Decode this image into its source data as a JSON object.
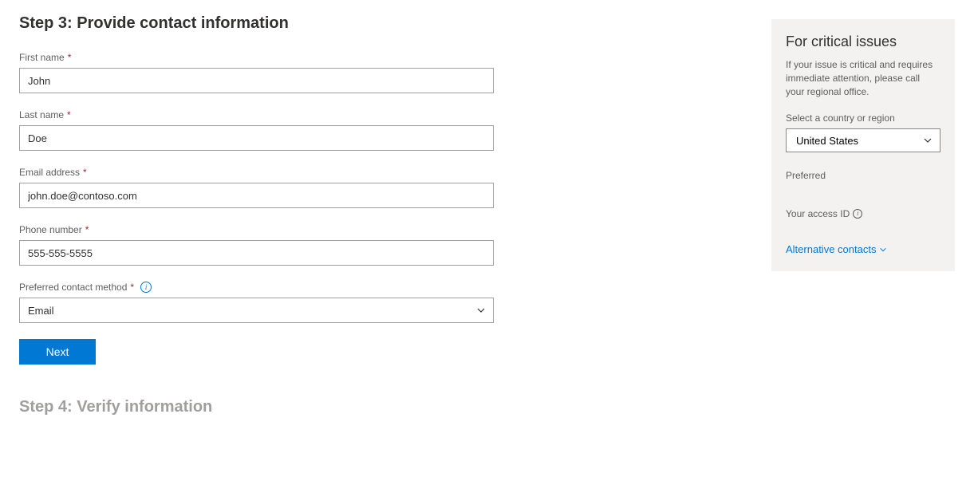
{
  "step3": {
    "title": "Step 3: Provide contact information",
    "firstNameLabel": "First name",
    "firstNameValue": "John",
    "lastNameLabel": "Last name",
    "lastNameValue": "Doe",
    "emailLabel": "Email address",
    "emailValue": "john.doe@contoso.com",
    "phoneLabel": "Phone number",
    "phoneValue": "555-555-5555",
    "contactMethodLabel": "Preferred contact method",
    "contactMethodValue": "Email",
    "nextButton": "Next"
  },
  "step4": {
    "title": "Step 4: Verify information"
  },
  "sidebar": {
    "title": "For critical issues",
    "description": "If your issue is critical and requires immediate attention, please call your regional office.",
    "countryLabel": "Select a country or region",
    "countryValue": "United States",
    "preferredLabel": "Preferred",
    "accessIdLabel": "Your access ID",
    "altContacts": "Alternative contacts"
  }
}
